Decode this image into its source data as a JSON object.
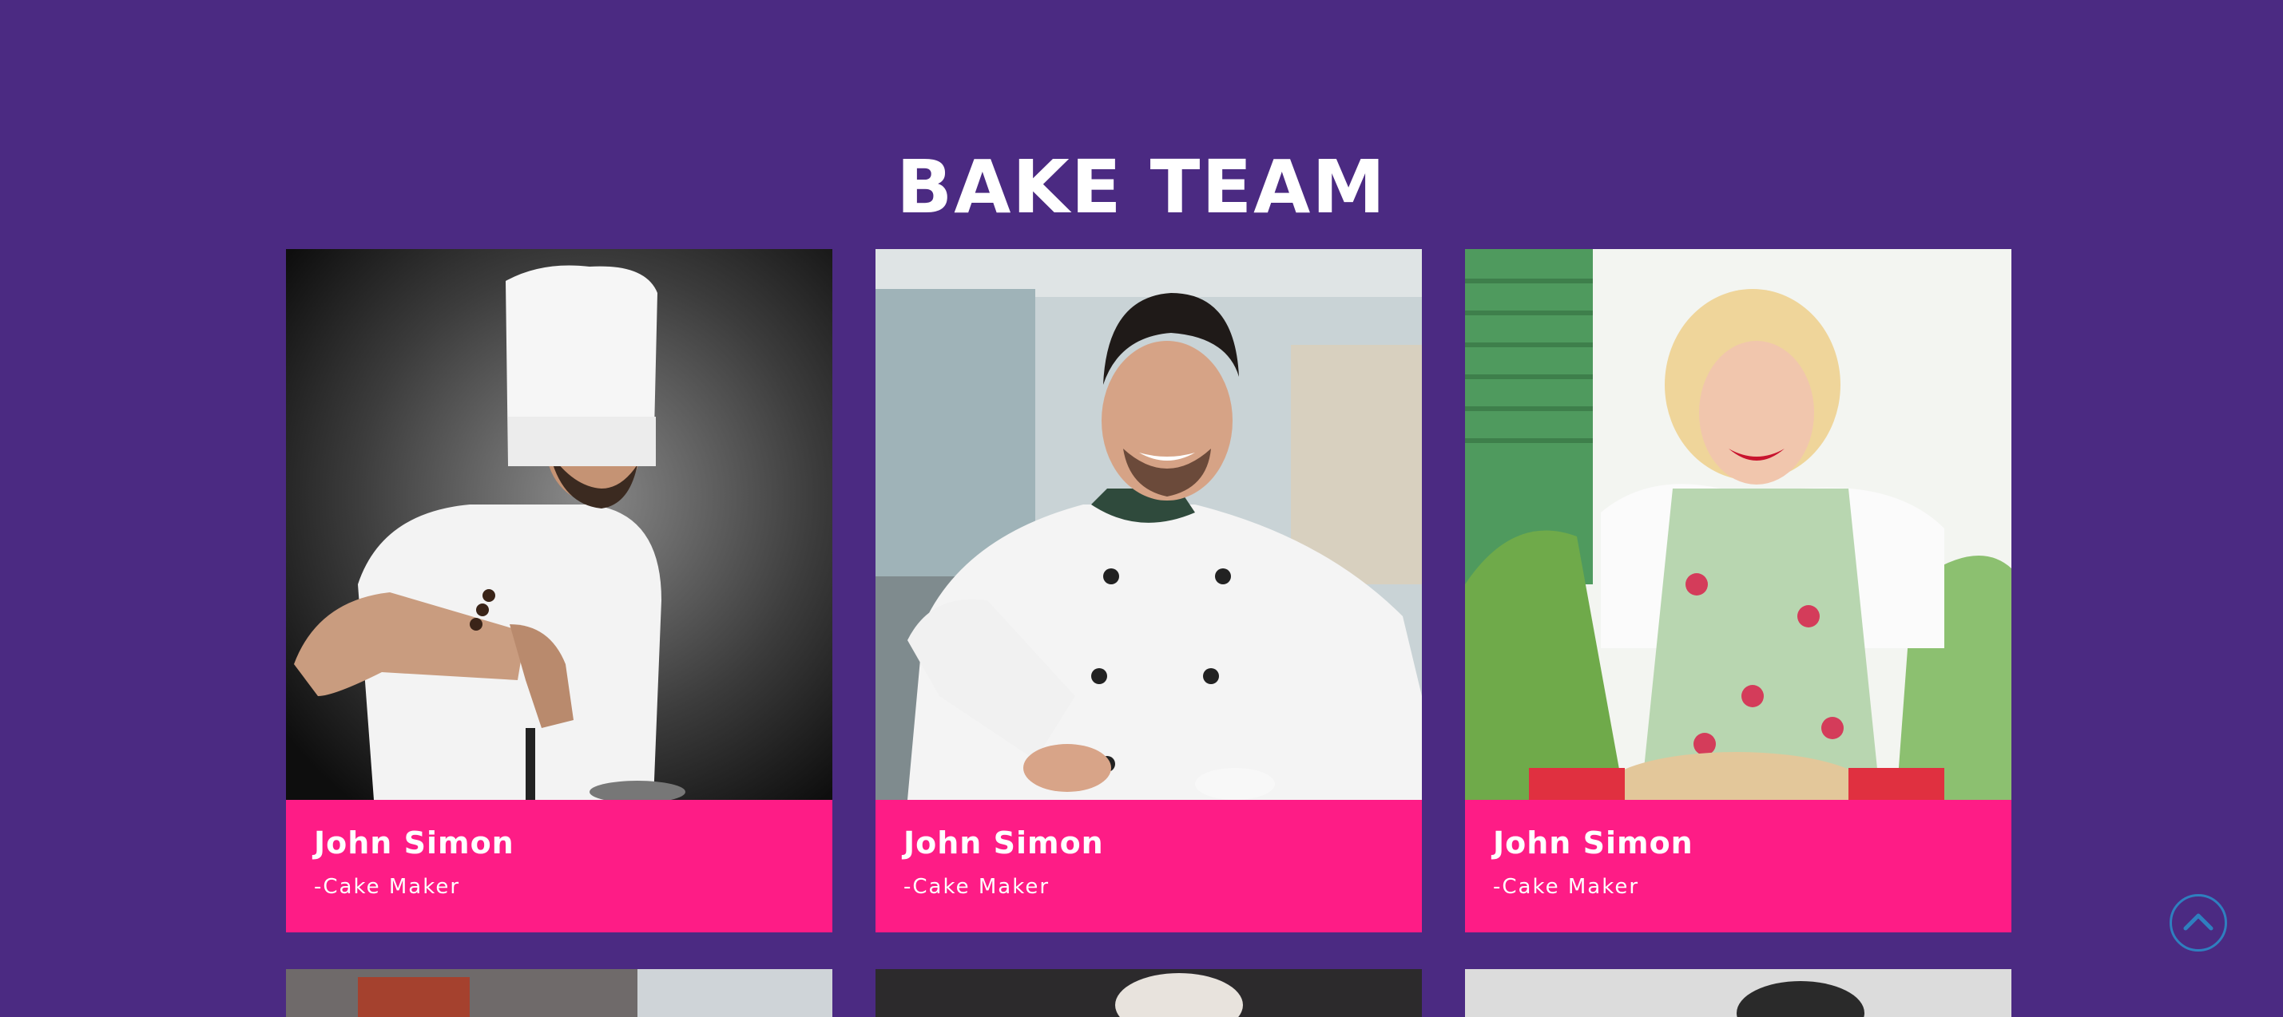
{
  "section": {
    "title": "BAKE TEAM"
  },
  "members": [
    {
      "name": "John Simon",
      "role": "-Cake Maker"
    },
    {
      "name": "John Simon",
      "role": "-Cake Maker"
    },
    {
      "name": "John Simon",
      "role": "-Cake Maker"
    }
  ],
  "icons": {
    "scroll_top": "chevron-up-icon"
  },
  "colors": {
    "background": "#4b2a82",
    "card_accent": "#fe1c86",
    "scroll_button": "#2f7fbf"
  }
}
